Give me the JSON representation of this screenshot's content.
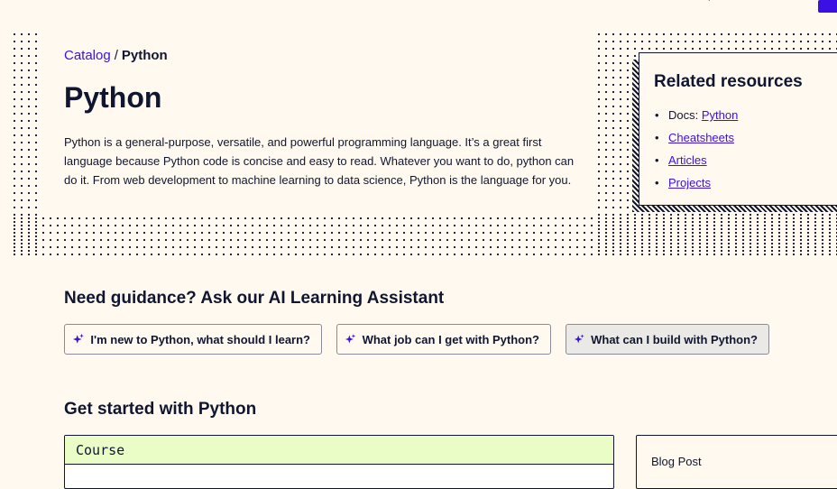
{
  "breadcrumb": {
    "catalog": "Catalog",
    "separator": "/",
    "current": "Python"
  },
  "hero": {
    "title": "Python",
    "description": "Python is a general-purpose, versatile, and powerful programming language. It’s a great first language because Python code is concise and easy to read. Whatever you want to do, python can do it. From web development to machine learning to data science, Python is the language for you."
  },
  "resources": {
    "heading": "Related resources",
    "docs_prefix": "Docs: ",
    "docs_link": "Python",
    "items": [
      "Cheatsheets",
      "Articles",
      "Projects"
    ]
  },
  "guidance": {
    "heading": "Need guidance? Ask our AI Learning Assistant",
    "prompts": [
      "I'm new to Python, what should I learn?",
      "What job can I get with Python?",
      "What can I build with Python?"
    ]
  },
  "start": {
    "heading": "Get started with Python",
    "course_label": "Course",
    "blog_label": "Blog Post"
  },
  "icons": {
    "prompt_icon": "sparkle-icon",
    "nav_icon": "search-icon"
  },
  "colors": {
    "background": "#fff9f0",
    "link": "#3a10e5",
    "text": "#10162f",
    "sparkle": "#3a10e5",
    "course_band": "#eafdc6"
  }
}
